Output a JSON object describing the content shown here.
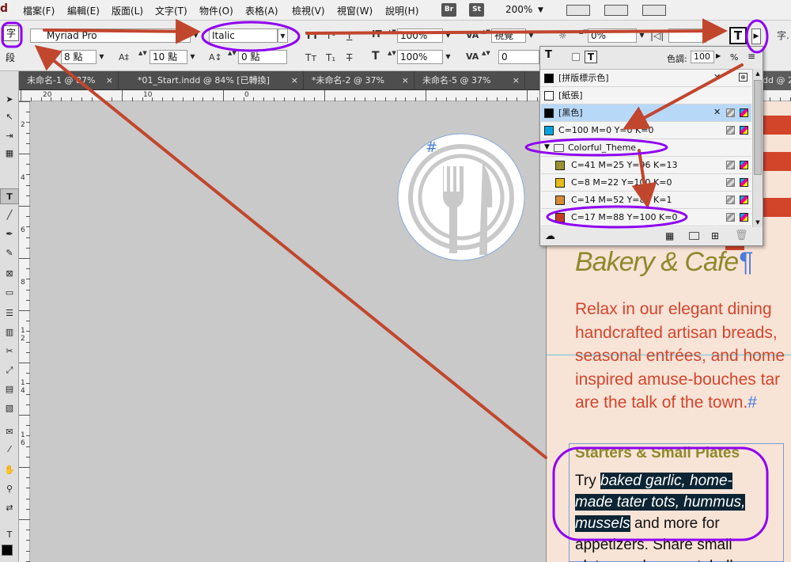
{
  "app": {
    "logo": "d"
  },
  "menubar": {
    "items": [
      "檔案(F)",
      "編輯(E)",
      "版面(L)",
      "文字(T)",
      "物件(O)",
      "表格(A)",
      "檢視(V)",
      "視窗(W)",
      "說明(H)"
    ],
    "app_buttons": [
      "Br",
      "St"
    ],
    "zoom": "200%"
  },
  "control": {
    "char_mode": "字",
    "para_mode": "段",
    "font_family": "Myriad Pro",
    "font_style": "Italic",
    "font_size": "8 點",
    "leading": "10 點",
    "kerning": "視覺",
    "tracking": "0%",
    "scale_v": "100%",
    "scale_h": "100%",
    "baseline": "0 點",
    "skew": "0",
    "right_label": "字."
  },
  "tabs": [
    "未命名-1 @ 87%",
    "*01_Start.indd @ 84% [已轉換]",
    "*未命名-2 @ 37%",
    "未命名-5 @ 37%",
    "indd @ 2"
  ],
  "rulers": {
    "h": [
      "20",
      "10",
      "0"
    ],
    "v": [
      "2",
      "4",
      "6",
      "8",
      "1",
      "2",
      "1",
      "4",
      "1",
      "6"
    ]
  },
  "swatches": {
    "tint_label": "色調:",
    "tint_value": "100",
    "tint_unit": "%",
    "rows": [
      {
        "name": "[拼版標示色]",
        "color": "#000000"
      },
      {
        "name": "[紙張]",
        "color": "#ffffff"
      },
      {
        "name": "[黑色]",
        "color": "#000000"
      },
      {
        "name": "C=100 M=0 Y=0 K=0",
        "color": "#00a3e0"
      },
      {
        "name": "Colorful_Theme",
        "color": ""
      },
      {
        "name": "C=41 M=25 Y=96 K=13",
        "color": "#99922f"
      },
      {
        "name": "C=8 M=22 Y=100 K=0",
        "color": "#e9bb1a"
      },
      {
        "name": "C=14 M=52 Y=87 K=1",
        "color": "#d98834"
      },
      {
        "name": "C=17 M=88 Y=100 K=0",
        "color": "#c93a25"
      }
    ]
  },
  "document": {
    "subtitle": "Bakery & Cafe",
    "intro_lines": [
      "Relax in our elegant dining",
      "handcrafted artisan breads,",
      "seasonal entrées, and home",
      "inspired amuse-bouches tar",
      "are the talk of the town."
    ],
    "heading": "Starters & Small Plates",
    "body": {
      "try": "Try",
      "highlight1": "baked garlic, home-",
      "highlight2": "made tater tots, hummus,",
      "highlight3": "mussels",
      "after": "and more for",
      "line4": "appetizers. Share small",
      "line5": "plates such as portobello"
    },
    "hash": "#"
  },
  "colors": {
    "accent_purple": "#8f00f0",
    "arrow": "#c1462e",
    "olive": "#8d8a2b",
    "red_text": "#d2452b"
  }
}
